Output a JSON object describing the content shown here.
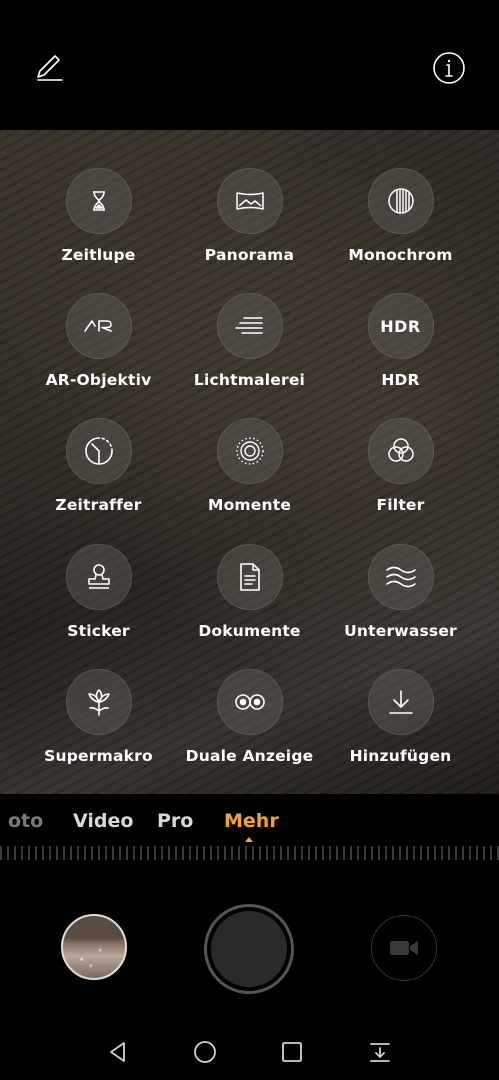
{
  "toolbar": {
    "edit_icon": "edit-pencil-icon",
    "info_icon": "info-icon"
  },
  "modes": [
    {
      "label": "Zeitlupe",
      "icon": "hourglass-icon"
    },
    {
      "label": "Panorama",
      "icon": "panorama-icon"
    },
    {
      "label": "Monochrom",
      "icon": "monochrome-icon"
    },
    {
      "label": "AR-Objektiv",
      "icon": "ar-lens-icon",
      "icon_text": "AR"
    },
    {
      "label": "Lichtmalerei",
      "icon": "light-painting-icon"
    },
    {
      "label": "HDR",
      "icon": "hdr-icon",
      "icon_text": "HDR"
    },
    {
      "label": "Zeitraffer",
      "icon": "time-lapse-icon"
    },
    {
      "label": "Momente",
      "icon": "moments-icon"
    },
    {
      "label": "Filter",
      "icon": "filter-icon"
    },
    {
      "label": "Sticker",
      "icon": "sticker-stamp-icon"
    },
    {
      "label": "Dokumente",
      "icon": "document-icon"
    },
    {
      "label": "Unterwasser",
      "icon": "underwater-waves-icon"
    },
    {
      "label": "Supermakro",
      "icon": "flower-macro-icon"
    },
    {
      "label": "Duale Anzeige",
      "icon": "dual-view-icon"
    },
    {
      "label": "Hinzufügen",
      "icon": "download-add-icon"
    }
  ],
  "mode_bar": {
    "tabs": [
      {
        "label": "oto",
        "state": "partial"
      },
      {
        "label": "Video",
        "state": "normal"
      },
      {
        "label": "Pro",
        "state": "normal"
      },
      {
        "label": "Mehr",
        "state": "active"
      }
    ],
    "active_color": "#f5a623"
  },
  "controls": {
    "gallery": "gallery-thumbnail",
    "shutter": "shutter-button",
    "video": "video-camera-icon"
  },
  "navigation": {
    "back": "back-triangle-icon",
    "home": "home-circle-icon",
    "recents": "recents-square-icon",
    "notifications": "pull-down-icon"
  }
}
